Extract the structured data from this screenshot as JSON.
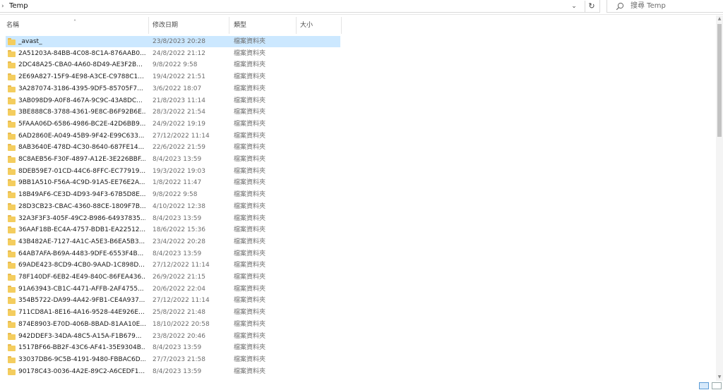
{
  "address": {
    "path": "Temp",
    "refresh_icon": "refresh-icon",
    "dropdown_icon": "chevron-down-icon"
  },
  "search": {
    "placeholder": "搜尋 Temp"
  },
  "columns": {
    "name": "名稱",
    "date": "修改日期",
    "type": "類型",
    "size": "大小"
  },
  "files": [
    {
      "name": "_avast_",
      "date": "23/8/2023 20:28",
      "type": "檔案資料夾",
      "selected": true
    },
    {
      "name": "2A51203A-84BB-4C08-8C1A-876AAB0...",
      "date": "24/8/2022 21:12",
      "type": "檔案資料夾"
    },
    {
      "name": "2DC48A25-CBA0-4A60-8D49-AE3F2B...",
      "date": "9/8/2022 9:58",
      "type": "檔案資料夾"
    },
    {
      "name": "2E69A827-15F9-4E98-A3CE-C9788C1...",
      "date": "19/4/2022 21:51",
      "type": "檔案資料夾"
    },
    {
      "name": "3A287074-3186-4395-9DF5-85705F7...",
      "date": "3/6/2022 18:07",
      "type": "檔案資料夾"
    },
    {
      "name": "3AB098D9-A0F8-467A-9C9C-43A8DC...",
      "date": "21/8/2023 11:14",
      "type": "檔案資料夾"
    },
    {
      "name": "3BE888C8-3788-4361-9E8C-B6F92B6E...",
      "date": "28/3/2022 21:54",
      "type": "檔案資料夾"
    },
    {
      "name": "5FAAA06D-6586-4986-BC2E-42D6BB9...",
      "date": "24/9/2022 19:19",
      "type": "檔案資料夾"
    },
    {
      "name": "6AD2860E-A049-45B9-9F42-E99C633...",
      "date": "27/12/2022 11:14",
      "type": "檔案資料夾"
    },
    {
      "name": "8AB3640E-478D-4C30-8640-687FE14...",
      "date": "22/6/2022 21:59",
      "type": "檔案資料夾"
    },
    {
      "name": "8C8AEB56-F30F-4897-A12E-3E226BBF...",
      "date": "8/4/2023 13:59",
      "type": "檔案資料夾"
    },
    {
      "name": "8DEB59E7-01CD-44C6-8FFC-EC77919...",
      "date": "19/3/2022 19:03",
      "type": "檔案資料夾"
    },
    {
      "name": "9BB1A510-F56A-4C9D-91A5-EE76E2A...",
      "date": "1/8/2022 11:47",
      "type": "檔案資料夾"
    },
    {
      "name": "18B49AF6-CE3D-4D93-94F3-67B5D8E...",
      "date": "9/8/2022 9:58",
      "type": "檔案資料夾"
    },
    {
      "name": "28D3CB23-CBAC-4360-88CE-1809F7B...",
      "date": "4/10/2022 12:38",
      "type": "檔案資料夾"
    },
    {
      "name": "32A3F3F3-405F-49C2-B986-64937835...",
      "date": "8/4/2023 13:59",
      "type": "檔案資料夾"
    },
    {
      "name": "36AAF18B-EC4A-4757-BDB1-EA22512...",
      "date": "18/6/2022 15:36",
      "type": "檔案資料夾"
    },
    {
      "name": "43B482AE-7127-4A1C-A5E3-B6EA5B3...",
      "date": "23/4/2022 20:28",
      "type": "檔案資料夾"
    },
    {
      "name": "64AB7AFA-B69A-4483-9DFE-6553F4B...",
      "date": "8/4/2023 13:59",
      "type": "檔案資料夾"
    },
    {
      "name": "69ADE423-8CD9-4CB0-9AAD-1C898D...",
      "date": "27/12/2022 11:14",
      "type": "檔案資料夾"
    },
    {
      "name": "78F140DF-6EB2-4E49-840C-86FEA436...",
      "date": "26/9/2022 21:15",
      "type": "檔案資料夾"
    },
    {
      "name": "91A63943-CB1C-4471-AFFB-2AF4755...",
      "date": "20/6/2022 22:04",
      "type": "檔案資料夾"
    },
    {
      "name": "354B5722-DA99-4A42-9FB1-CE4A937...",
      "date": "27/12/2022 11:14",
      "type": "檔案資料夾"
    },
    {
      "name": "711CD8A1-8E16-4A16-9528-44E926E...",
      "date": "25/8/2022 21:48",
      "type": "檔案資料夾"
    },
    {
      "name": "874E8903-E70D-406B-8BAD-81AA10E...",
      "date": "18/10/2022 20:58",
      "type": "檔案資料夾"
    },
    {
      "name": "942DDEF3-34DA-48C5-A15A-F1B679...",
      "date": "23/8/2022 20:46",
      "type": "檔案資料夾"
    },
    {
      "name": "1517BF66-BB2F-43C6-AF41-35E9304B...",
      "date": "8/4/2023 13:59",
      "type": "檔案資料夾"
    },
    {
      "name": "33037DB6-9C5B-4191-9480-FBBAC6D...",
      "date": "27/7/2023 21:58",
      "type": "檔案資料夾"
    },
    {
      "name": "90178C43-0036-4A2E-89C2-A6CEDF1...",
      "date": "8/4/2023 13:59",
      "type": "檔案資料夾"
    }
  ],
  "colors": {
    "selected_row": "#cce8ff",
    "folder": "#f4cd5e"
  }
}
